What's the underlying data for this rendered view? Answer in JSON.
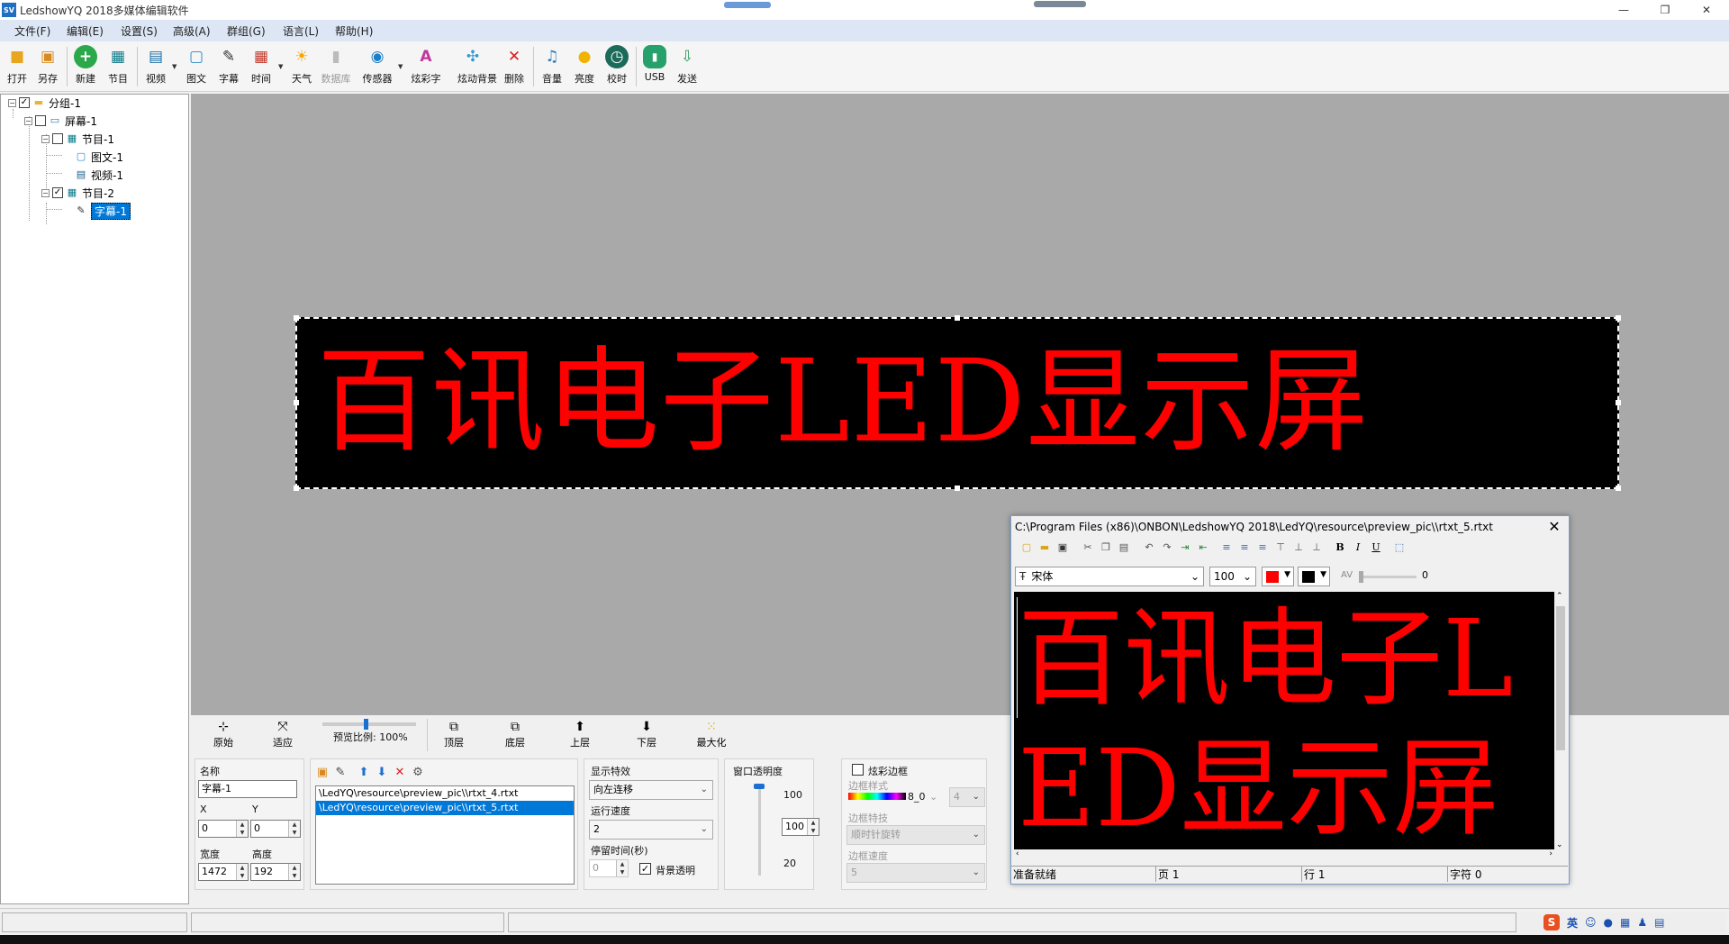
{
  "app": {
    "title": "LedshowYQ 2018多媒体编辑软件",
    "icon_text": "SV"
  },
  "window_controls": {
    "minimize": "—",
    "maximize": "❐",
    "close": "✕"
  },
  "menu": [
    "文件(F)",
    "编辑(E)",
    "设置(S)",
    "高级(A)",
    "群组(G)",
    "语言(L)",
    "帮助(H)"
  ],
  "toolbar": {
    "open": "打开",
    "saveas": "另存",
    "new": "新建",
    "program": "节目",
    "video": "视频",
    "picture": "图文",
    "subtitle": "字幕",
    "time": "时间",
    "weather": "天气",
    "database": "数据库",
    "sensor": "传感器",
    "colorful": "炫彩字",
    "animbg": "炫动背景",
    "delete": "删除",
    "volume": "音量",
    "brightness": "亮度",
    "timing": "校时",
    "usb": "USB",
    "send": "发送"
  },
  "tree": {
    "group": "分组-1",
    "screen": "屏幕-1",
    "program1": "节目-1",
    "picture": "图文-1",
    "video": "视频-1",
    "program2": "节目-2",
    "subtitle": "字幕-1"
  },
  "led": {
    "text": "百讯电子LED显示屏",
    "text_color": "#ff0000",
    "bg_color": "#000000"
  },
  "view_bar": {
    "original": "原始",
    "fit": "适应",
    "preview_ratio": "预览比例: 100%",
    "top": "顶层",
    "bottom": "底层",
    "up": "上层",
    "down": "下层",
    "maximize": "最大化"
  },
  "props": {
    "name_label": "名称",
    "name_value": "字幕-1",
    "x_label": "X",
    "x_value": "0",
    "y_label": "Y",
    "y_value": "0",
    "w_label": "宽度",
    "w_value": "1472",
    "h_label": "高度",
    "h_value": "192",
    "files": [
      "\\LedYQ\\resource\\preview_pic\\\\rtxt_4.rtxt",
      "\\LedYQ\\resource\\preview_pic\\\\rtxt_5.rtxt"
    ],
    "effect_label": "显示特效",
    "effect_value": "向左连移",
    "speed_label": "运行速度",
    "speed_value": "2",
    "stay_label": "停留时间(秒)",
    "stay_value": "0",
    "bg_transparent": "背景透明",
    "opacity_label": "窗口透明度",
    "opacity_max": "100",
    "opacity_value": "100",
    "opacity_min": "20",
    "border_label": "炫彩边框",
    "border_style_label": "边框样式",
    "border_style_value": "8_0",
    "border_width": "4",
    "border_effect_label": "边框特技",
    "border_effect_value": "顺时针旋转",
    "border_speed_label": "边框速度",
    "border_speed_value": "5"
  },
  "editor": {
    "path": "C:\\Program Files (x86)\\ONBON\\LedshowYQ 2018\\LedYQ\\resource\\preview_pic\\\\rtxt_5.rtxt",
    "font": "宋体",
    "font_icon": "Ŧ",
    "size": "100",
    "spacing": "0",
    "text_color": "#ff0000",
    "bg_color": "#000000",
    "content": "百讯电子LED显示屏",
    "status": {
      "ready": "准备就绪",
      "page": "页 1",
      "line": "行 1",
      "chars": "字符 0"
    }
  },
  "tray": {
    "lang": "英"
  }
}
